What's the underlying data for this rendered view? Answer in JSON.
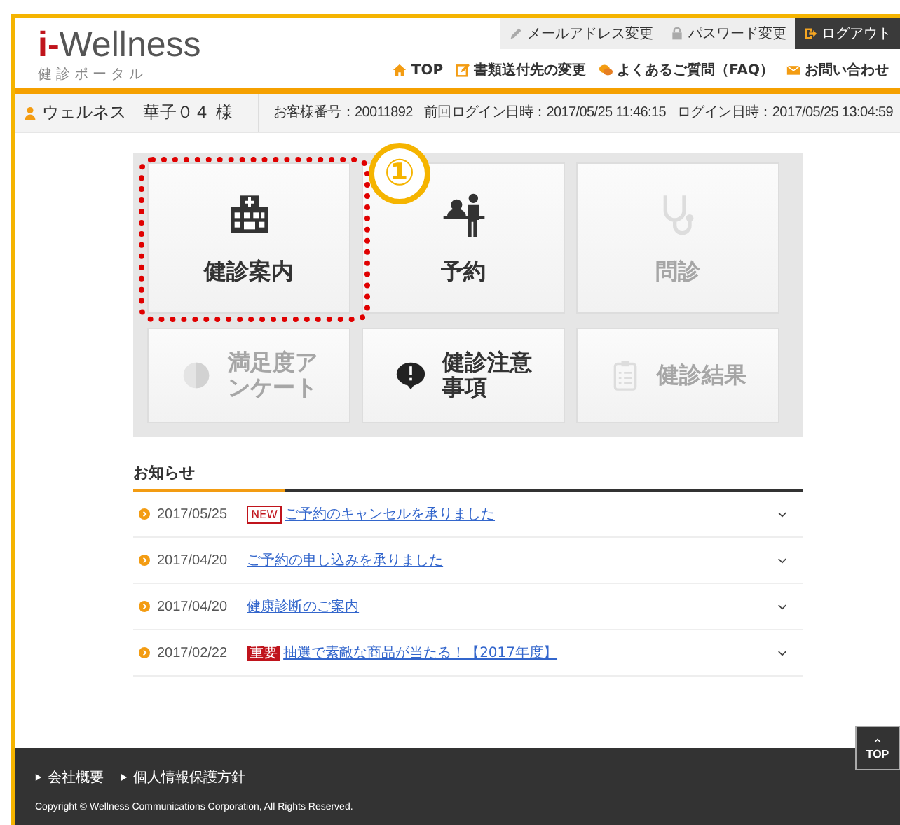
{
  "header": {
    "logo": {
      "accent": "i-",
      "text": "Wellness"
    },
    "subtitle": "健診ポータル",
    "account_links": [
      {
        "kind": "pencil",
        "label": "メールアドレス変更"
      },
      {
        "kind": "lock",
        "label": "パスワード変更"
      },
      {
        "kind": "logout",
        "label": "ログアウト"
      }
    ],
    "nav_links": [
      {
        "kind": "home",
        "label": "TOP"
      },
      {
        "kind": "edit",
        "label": "書類送付先の変更"
      },
      {
        "kind": "chat",
        "label": "よくあるご質問（FAQ）"
      },
      {
        "kind": "mail",
        "label": "お問い合わせ"
      }
    ]
  },
  "user_bar": {
    "name": "ウェルネス　華子０４ 様",
    "details": [
      "お客様番号：20011892",
      "前回ログイン日時：2017/05/25 11:46:15",
      "ログイン日時：2017/05/25 13:04:59"
    ]
  },
  "tiles": [
    {
      "label": "健診案内",
      "kind": "hospital",
      "disabled": false,
      "highlighted": true
    },
    {
      "label": "予約",
      "kind": "reception",
      "disabled": false,
      "highlighted": false
    },
    {
      "label": "問診",
      "kind": "stethoscope",
      "disabled": true,
      "highlighted": false
    },
    {
      "label": "満足度アンケート",
      "kind": "pie",
      "disabled": true,
      "highlighted": false
    },
    {
      "label": "健診注意事項",
      "kind": "alert",
      "disabled": false,
      "highlighted": false
    },
    {
      "label": "健診結果",
      "kind": "clipboard",
      "disabled": true,
      "highlighted": false
    }
  ],
  "callout": "①",
  "news": {
    "title": "お知らせ",
    "items": [
      {
        "date": "2017/05/25",
        "badge": {
          "kind": "new",
          "text": "NEW"
        },
        "title": "ご予約のキャンセルを承りました"
      },
      {
        "date": "2017/04/20",
        "title": "ご予約の申し込みを承りました"
      },
      {
        "date": "2017/04/20",
        "title": "健康診断のご案内"
      },
      {
        "date": "2017/02/22",
        "badge": {
          "kind": "important",
          "text": "重要"
        },
        "title": "抽選で素敵な商品が当たる！【2017年度】"
      }
    ]
  },
  "page_top": "TOP",
  "footer": {
    "links": [
      "会社概要",
      "個人情報保護方針"
    ],
    "copyright": "Copyright © Wellness Communications Corporation, All Rights Reserved."
  }
}
